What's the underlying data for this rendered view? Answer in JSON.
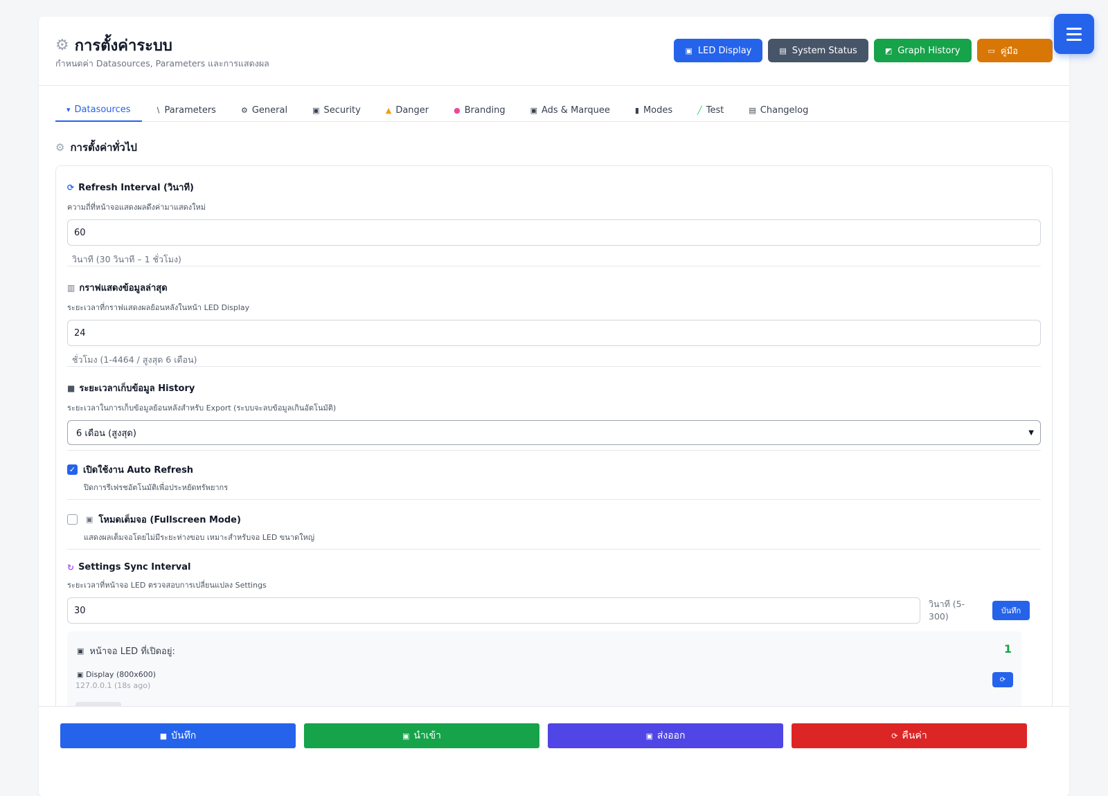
{
  "header": {
    "title": "การตั้งค่าระบบ",
    "subtitle": "กำหนดค่า Datasources, Parameters และการแสดงผล",
    "buttons": [
      {
        "label": "LED Display",
        "color": "#2563eb"
      },
      {
        "label": "System Status",
        "color": "#475569"
      },
      {
        "label": "Graph History",
        "color": "#16a34a"
      },
      {
        "label": "คู่มือ",
        "color": "#d97706"
      }
    ]
  },
  "tabs": [
    {
      "label": "Datasources",
      "icon": "plug-icon",
      "active": true
    },
    {
      "label": "Parameters",
      "icon": "ruler-icon"
    },
    {
      "label": "General",
      "icon": "gear-icon"
    },
    {
      "label": "Security",
      "icon": "lock-icon"
    },
    {
      "label": "Danger",
      "icon": "warning-icon"
    },
    {
      "label": "Branding",
      "icon": "palette-icon"
    },
    {
      "label": "Ads & Marquee",
      "icon": "monitor-icon"
    },
    {
      "label": "Modes",
      "icon": "traffic-light-icon"
    },
    {
      "label": "Test",
      "icon": "test-tube-icon"
    },
    {
      "label": "Changelog",
      "icon": "clipboard-icon"
    }
  ],
  "section": {
    "title": "การตั้งค่าทั่วไป"
  },
  "refresh": {
    "label": "Refresh Interval (วินาที)",
    "desc": "ความถี่ที่หน้าจอแสดงผลดึงค่ามาแสดงใหม่",
    "value": "60",
    "hint": "วินาที (30 วินาที – 1 ชั่วโมง)"
  },
  "graph": {
    "label": "กราฟแสดงข้อมูลล่าสุด",
    "desc": "ระยะเวลาที่กราฟแสดงผลย้อนหลังในหน้า LED Display",
    "value": "24",
    "hint": "ชั่วโมง (1-4464 / สูงสุด 6 เดือน)"
  },
  "history": {
    "label": "ระยะเวลาเก็บข้อมูล History",
    "desc": "ระยะเวลาในการเก็บข้อมูลย้อนหลังสำหรับ Export (ระบบจะลบข้อมูลเกินอัตโนมัติ)",
    "selected": "6 เดือน (สูงสุด)"
  },
  "auto_refresh": {
    "label": "เปิดใช้งาน Auto Refresh",
    "desc": "ปิดการรีเฟรชอัตโนมัติเพื่อประหยัดทรัพยากร",
    "checked": true
  },
  "fullscreen": {
    "label": "โหมดเต็มจอ (Fullscreen Mode)",
    "desc": "แสดงผลเต็มจอโดยไม่มีระยะห่างขอบ เหมาะสำหรับจอ LED ขนาดใหญ่",
    "checked": false
  },
  "sync": {
    "label": "Settings Sync Interval",
    "desc": "ระยะเวลาที่หน้าจอ LED ตรวจสอบการเปลี่ยนแปลง Settings",
    "value": "30",
    "unit": "วินาที (5-300)",
    "save_label": "บันทึก"
  },
  "led_open": {
    "title": "หน้าจอ LED ที่เปิดอยู่:",
    "count": "1",
    "item": "Display (800x600)",
    "ip": "127.0.0.1 (18s ago)"
  },
  "footer": {
    "buttons": [
      {
        "label": "บันทึก",
        "icon": "floppy-icon",
        "color": "#2563eb"
      },
      {
        "label": "นำเข้า",
        "icon": "inbox-icon",
        "color": "#16a34a"
      },
      {
        "label": "ส่งออก",
        "icon": "outbox-icon",
        "color": "#4f46e5"
      },
      {
        "label": "คืนค่า",
        "icon": "reset-icon",
        "color": "#dc2626"
      }
    ]
  }
}
